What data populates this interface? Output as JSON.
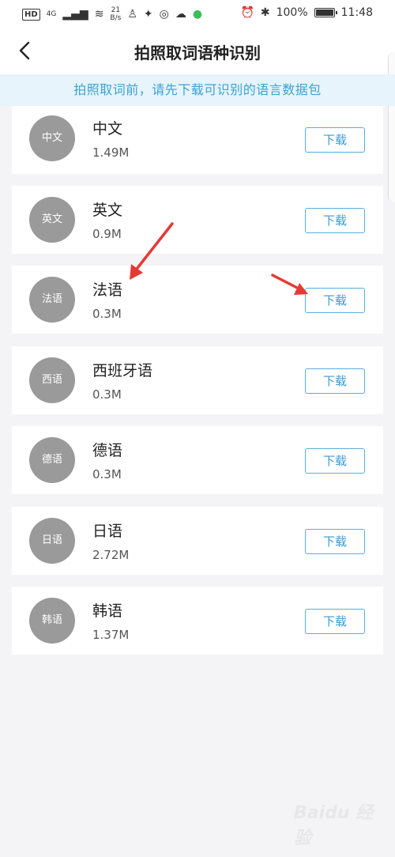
{
  "status": {
    "hd": "HD",
    "net": "4G",
    "speed_value": "21",
    "speed_unit": "B/s",
    "battery": "100%",
    "time": "11:48"
  },
  "header": {
    "title": "拍照取词语种识别"
  },
  "notice": "拍照取词前，请先下载可识别的语言数据包",
  "languages": [
    {
      "avatar": "中文",
      "name": "中文",
      "size": "1.49M",
      "button": "下载"
    },
    {
      "avatar": "英文",
      "name": "英文",
      "size": "0.9M",
      "button": "下载"
    },
    {
      "avatar": "法语",
      "name": "法语",
      "size": "0.3M",
      "button": "下载"
    },
    {
      "avatar": "西语",
      "name": "西班牙语",
      "size": "0.3M",
      "button": "下载"
    },
    {
      "avatar": "德语",
      "name": "德语",
      "size": "0.3M",
      "button": "下载"
    },
    {
      "avatar": "日语",
      "name": "日语",
      "size": "2.72M",
      "button": "下载"
    },
    {
      "avatar": "韩语",
      "name": "韩语",
      "size": "1.37M",
      "button": "下载"
    }
  ],
  "watermark": "Baidu 经验",
  "colors": {
    "accent": "#3a9bd8",
    "notice_bg": "#e7f4fb",
    "annotation_arrow": "#e53935"
  }
}
